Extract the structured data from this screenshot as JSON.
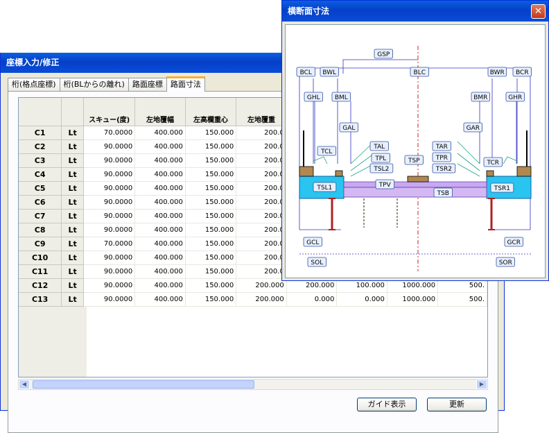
{
  "main": {
    "title": "座標入力/修正",
    "tabs": [
      "桁(格点座標)",
      "桁(BLからの離れ)",
      "路面座標",
      "路面寸法"
    ],
    "columns": [
      "スキュー(度)",
      "左地覆幅",
      "左高欄重心",
      "左地覆重"
    ],
    "rows": [
      {
        "id": "C1",
        "side": "Lt",
        "vals": [
          "70.0000",
          "400.000",
          "150.000",
          "200.0"
        ]
      },
      {
        "id": "C2",
        "side": "Lt",
        "vals": [
          "90.0000",
          "400.000",
          "150.000",
          "200.0"
        ]
      },
      {
        "id": "C3",
        "side": "Lt",
        "vals": [
          "90.0000",
          "400.000",
          "150.000",
          "200.0"
        ]
      },
      {
        "id": "C4",
        "side": "Lt",
        "vals": [
          "90.0000",
          "400.000",
          "150.000",
          "200.0"
        ]
      },
      {
        "id": "C5",
        "side": "Lt",
        "vals": [
          "90.0000",
          "400.000",
          "150.000",
          "200.0"
        ]
      },
      {
        "id": "C6",
        "side": "Lt",
        "vals": [
          "90.0000",
          "400.000",
          "150.000",
          "200.0"
        ]
      },
      {
        "id": "C7",
        "side": "Lt",
        "vals": [
          "90.0000",
          "400.000",
          "150.000",
          "200.0"
        ]
      },
      {
        "id": "C8",
        "side": "Lt",
        "vals": [
          "90.0000",
          "400.000",
          "150.000",
          "200.0"
        ]
      },
      {
        "id": "C9",
        "side": "Lt",
        "vals": [
          "70.0000",
          "400.000",
          "150.000",
          "200.0"
        ]
      },
      {
        "id": "C10",
        "side": "Lt",
        "vals": [
          "90.0000",
          "400.000",
          "150.000",
          "200.0"
        ]
      },
      {
        "id": "C11",
        "side": "Lt",
        "vals": [
          "90.0000",
          "400.000",
          "150.000",
          "200.0"
        ]
      },
      {
        "id": "C12",
        "side": "Lt",
        "vals": [
          "90.0000",
          "400.000",
          "150.000",
          "200.000",
          "200.000",
          "100.000",
          "1000.000",
          "500."
        ]
      },
      {
        "id": "C13",
        "side": "Lt",
        "vals": [
          "90.0000",
          "400.000",
          "150.000",
          "200.000",
          "0.000",
          "0.000",
          "1000.000",
          "500."
        ]
      }
    ],
    "buttons": {
      "guide": "ガイド表示",
      "update": "更新"
    }
  },
  "popup": {
    "title": "横断面寸法",
    "close": "✕",
    "labels": {
      "gsp": "GSP",
      "bcl": "BCL",
      "bwl": "BWL",
      "blc": "BLC",
      "bwr": "BWR",
      "bcr": "BCR",
      "ghl": "GHL",
      "bml": "BML",
      "bmr": "BMR",
      "ghr": "GHR",
      "gal": "GAL",
      "gar": "GAR",
      "tcl": "TCL",
      "tal": "TAL",
      "tar": "TAR",
      "tpl": "TPL",
      "tpr": "TPR",
      "tsl2": "TSL2",
      "tsr2": "TSR2",
      "tsp": "TSP",
      "tcr": "TCR",
      "tpv": "TPV",
      "tsl1": "TSL1",
      "tsr1": "TSR1",
      "tsb": "TSB",
      "gcl": "GCL",
      "gcr": "GCR",
      "sol": "SOL",
      "sor": "SOR"
    }
  },
  "colors": {
    "titlebar": "#0a4cd8",
    "slab": "#29c4f0",
    "pavement": "#c8a8f0",
    "curb": "#b08850",
    "guide": "#20a080",
    "dim": "#3030c0",
    "center": "#d02020"
  }
}
